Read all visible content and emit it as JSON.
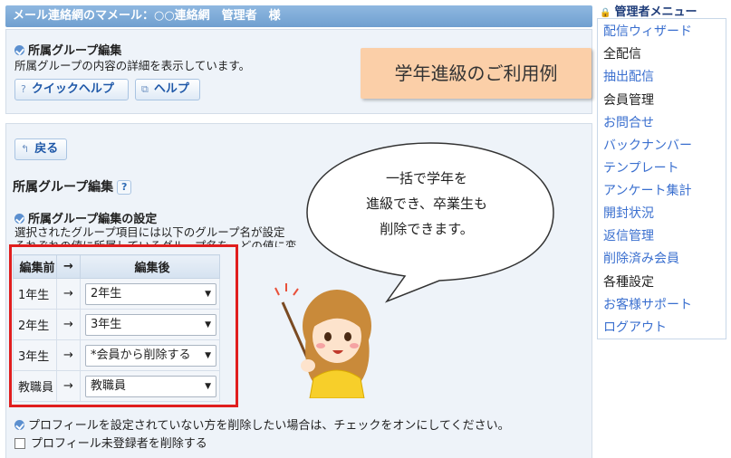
{
  "header": {
    "title": "メール連絡網のマメール：○○連絡網　管理者　様"
  },
  "top": {
    "section_title": "所属グループ編集",
    "description": "所属グループの内容の詳細を表示しています。",
    "quick_help_label": "クイックヘルプ",
    "help_label": "ヘルプ"
  },
  "callout": {
    "text": "学年進級のご利用例"
  },
  "main": {
    "back_label": "戻る",
    "page_title": "所属グループ編集",
    "help_mark": "?",
    "settings_title": "所属グループ編集の設定",
    "desc_line1": "選択されたグループ項目には以下のグループ名が設定",
    "desc_line2": "それぞれの値に所属しているグループ名を、どの値に変"
  },
  "table": {
    "headers": [
      "編集前",
      "→",
      "編集後"
    ],
    "rows": [
      {
        "before": "1年生",
        "arrow": "→",
        "after": "2年生"
      },
      {
        "before": "2年生",
        "arrow": "→",
        "after": "3年生"
      },
      {
        "before": "3年生",
        "arrow": "→",
        "after": "*会員から削除する"
      },
      {
        "before": "教職員",
        "arrow": "→",
        "after": "教職員"
      }
    ]
  },
  "bubble": {
    "line1": "一括で学年を",
    "line2": "進級でき、卒業生も",
    "line3": "削除できます。"
  },
  "bottom": {
    "note": "プロフィールを設定されていない方を削除したい場合は、チェックをオンにしてください。",
    "checkbox_label": "プロフィール未登録者を削除する",
    "checkbox_checked": false
  },
  "sidebar": {
    "title": "管理者メニュー",
    "items": [
      {
        "label": "配信ウィザード",
        "link": true
      },
      {
        "label": "全配信",
        "link": false
      },
      {
        "label": "抽出配信",
        "link": true
      },
      {
        "label": "会員管理",
        "link": false
      },
      {
        "label": "お問合せ",
        "link": true
      },
      {
        "label": "バックナンバー",
        "link": true
      },
      {
        "label": "テンプレート",
        "link": true
      },
      {
        "label": "アンケート集計",
        "link": true
      },
      {
        "label": "開封状況",
        "link": true
      },
      {
        "label": "返信管理",
        "link": true
      },
      {
        "label": "削除済み会員",
        "link": true
      },
      {
        "label": "各種設定",
        "link": false
      },
      {
        "label": "お客様サポート",
        "link": true
      },
      {
        "label": "ログアウト",
        "link": true
      }
    ]
  },
  "colors": {
    "header_bg": "#7fa9d8",
    "link": "#3a6fcf",
    "callout_bg": "#fbcfa8",
    "highlight_border": "#e01e1e"
  }
}
